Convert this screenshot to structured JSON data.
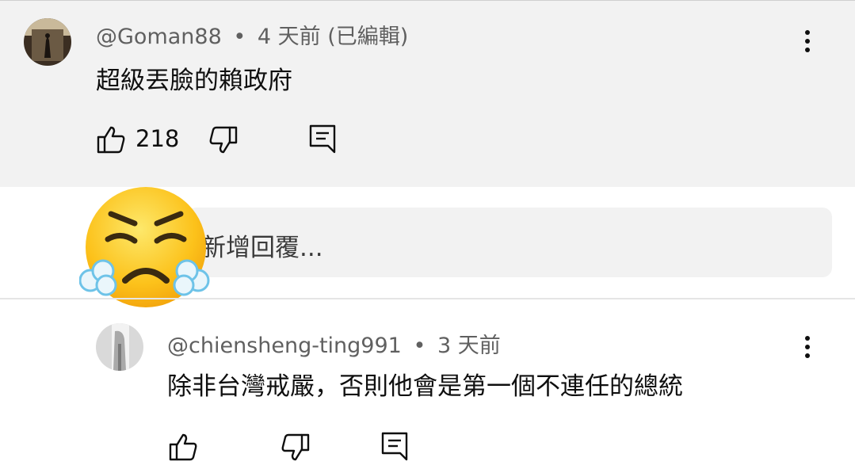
{
  "comment1": {
    "author": "@Goman88",
    "separator": "•",
    "time": "4 天前 (已編輯)",
    "text": "超級丟臉的賴政府",
    "likes": "218"
  },
  "reply_input": {
    "placeholder": "新增回覆..."
  },
  "comment2": {
    "author": "@chiensheng-ting991",
    "separator": "•",
    "time": "3 天前",
    "text": "除非台灣戒嚴，否則他會是第一個不連任的總統"
  },
  "icons": {
    "like": "thumbs-up-icon",
    "dislike": "thumbs-down-icon",
    "reply": "reply-comment-icon",
    "more": "more-vertical-icon",
    "emoji": "face-with-steam-from-nose-emoji"
  },
  "colors": {
    "highlight_bg": "#f2f2f2",
    "meta_text": "#606060",
    "emoji_face": "#fcc21b"
  }
}
